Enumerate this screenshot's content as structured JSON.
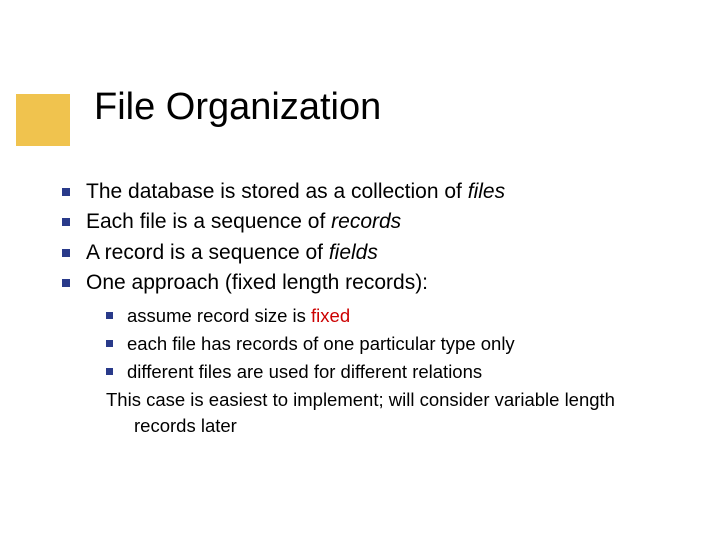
{
  "title": "File Organization",
  "bullets": [
    {
      "pre": "The database is stored as a collection of ",
      "em": "files"
    },
    {
      "pre": "Each file is a sequence of ",
      "em": "records"
    },
    {
      "pre": "A record is a sequence of ",
      "em": "fields"
    },
    {
      "pre": "One approach (fixed length records):",
      "em": ""
    }
  ],
  "sub": {
    "b1_pre": "assume record size is ",
    "b1_fixed": "fixed",
    "b2": "each file has records of one particular type only",
    "b3": "different files are used for different relations",
    "trailer": "This case is easiest to implement; will consider variable length records later"
  }
}
